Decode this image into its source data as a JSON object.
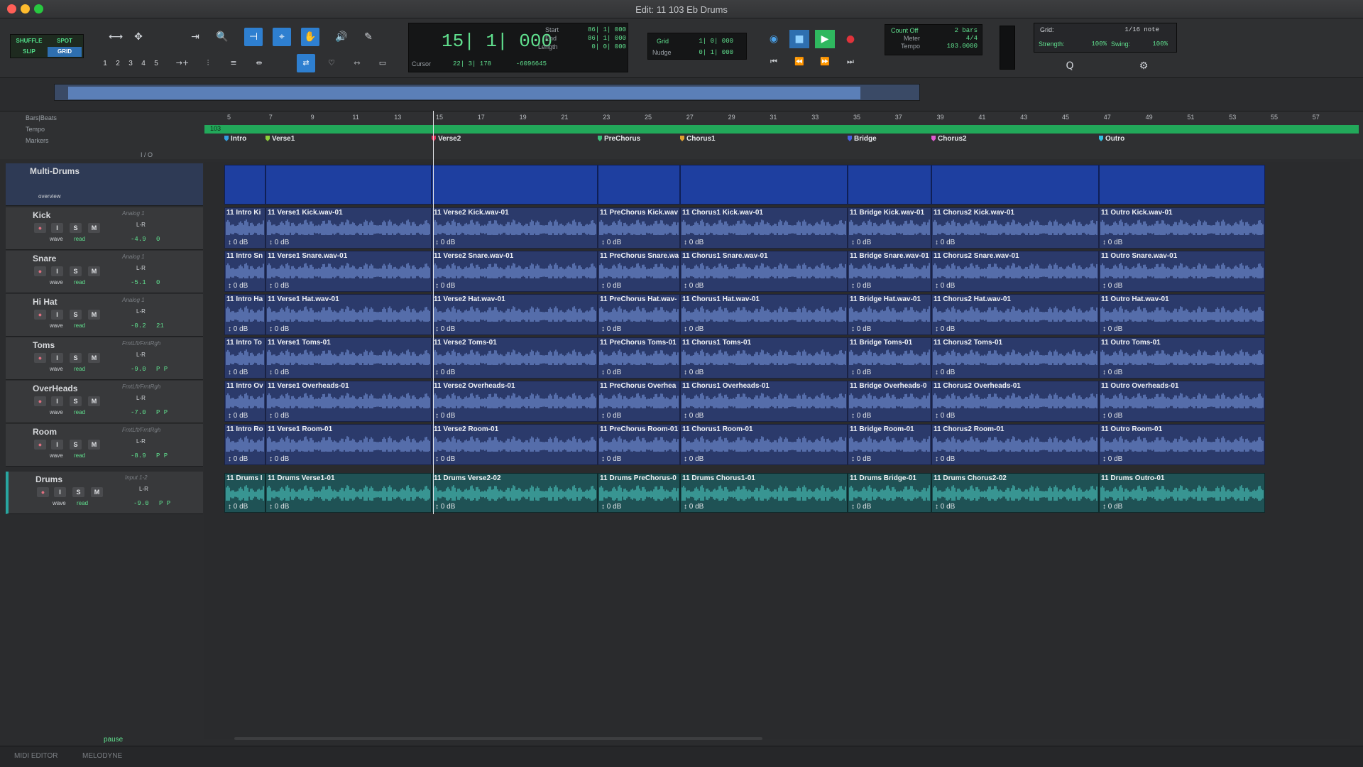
{
  "window": {
    "title": "Edit: 11 103 Eb Drums"
  },
  "edit_modes": [
    "SHUFFLE",
    "SPOT",
    "SLIP",
    "GRID"
  ],
  "zoom_presets": [
    "1",
    "2",
    "3",
    "4",
    "5"
  ],
  "counter": {
    "main": "15| 1| 000",
    "start_label": "Start",
    "start": "86| 1| 000",
    "end_label": "End",
    "end": "86| 1| 000",
    "length_label": "Length",
    "length": "0| 0| 000",
    "cursor_label": "Cursor",
    "cursor": "22| 3| 178",
    "sample": "-6096645"
  },
  "grid_nudge": {
    "grid_label": "Grid",
    "grid_value": "1| 0| 000",
    "nudge_label": "Nudge",
    "nudge_value": "0| 1| 000"
  },
  "count_meter": {
    "count": "Count Off",
    "count_value": "2 bars",
    "meter_label": "Meter",
    "meter": "4/4",
    "tempo_label": "Tempo",
    "tempo": "103.0000"
  },
  "grid_settings": {
    "grid_label": "Grid:",
    "grid_value": "1/16 note",
    "strength_label": "Strength:",
    "strength": "100%",
    "swing_label": "Swing:",
    "swing": "100%"
  },
  "rulers": {
    "bars_beats": "Bars|Beats",
    "tempo": "Tempo",
    "markers": "Markers",
    "tempo_value": "103",
    "io": "I / O"
  },
  "bar_ticks": [
    "5",
    "7",
    "9",
    "11",
    "13",
    "15",
    "17",
    "19",
    "21",
    "23",
    "25",
    "27",
    "29",
    "31",
    "33",
    "35",
    "37",
    "39",
    "41",
    "43",
    "45",
    "47",
    "49",
    "51",
    "53",
    "55",
    "57"
  ],
  "markers": [
    {
      "label": "Intro",
      "color": "#33a0e0"
    },
    {
      "label": "Verse1",
      "color": "#8ccf3a"
    },
    {
      "label": "Verse2",
      "color": "#e0335b"
    },
    {
      "label": "PreChorus",
      "color": "#3ac07a"
    },
    {
      "label": "Chorus1",
      "color": "#e0a030"
    },
    {
      "label": "Bridge",
      "color": "#4a62e0"
    },
    {
      "label": "Chorus2",
      "color": "#e05ad0"
    },
    {
      "label": "Outro",
      "color": "#33c0e0"
    }
  ],
  "multi_track": {
    "name": "Multi-Drums",
    "view": "overview"
  },
  "tracks": [
    {
      "name": "Kick",
      "input": "Analog 1",
      "pan": "L-R",
      "vol": "-4.9",
      "pan_val": "0",
      "view": "wave",
      "auto": "read",
      "clips": [
        "11 Intro Ki",
        "11 Verse1 Kick.wav-01",
        "11 Verse2 Kick.wav-01",
        "11 PreChorus Kick.wav",
        "11 Chorus1 Kick.wav-01",
        "11 Bridge Kick.wav-01",
        "11 Chorus2 Kick.wav-01",
        "11 Outro Kick.wav-01"
      ]
    },
    {
      "name": "Snare",
      "input": "Analog 1",
      "pan": "L-R",
      "vol": "-5.1",
      "pan_val": "0",
      "view": "wave",
      "auto": "read",
      "clips": [
        "11 Intro Sn",
        "11 Verse1 Snare.wav-01",
        "11 Verse2 Snare.wav-01",
        "11 PreChorus Snare.wa",
        "11 Chorus1 Snare.wav-01",
        "11 Bridge Snare.wav-01",
        "11 Chorus2 Snare.wav-01",
        "11 Outro Snare.wav-01"
      ]
    },
    {
      "name": "Hi Hat",
      "input": "Analog 1",
      "pan": "L-R",
      "vol": "-0.2",
      "pan_val": "21",
      "view": "wave",
      "auto": "read",
      "clips": [
        "11 Intro Ha",
        "11 Verse1 Hat.wav-01",
        "11 Verse2 Hat.wav-01",
        "11 PreChorus Hat.wav-",
        "11 Chorus1 Hat.wav-01",
        "11 Bridge Hat.wav-01",
        "11 Chorus2 Hat.wav-01",
        "11 Outro Hat.wav-01"
      ]
    },
    {
      "name": "Toms",
      "input": "FrntLft/FrntRgh",
      "pan": "L-R",
      "vol": "-9.0",
      "pan_val": "P  P",
      "view": "wave",
      "auto": "read",
      "clips": [
        "11 Intro To",
        "11 Verse1 Toms-01",
        "11 Verse2 Toms-01",
        "11 PreChorus Toms-01",
        "11 Chorus1 Toms-01",
        "11 Bridge Toms-01",
        "11 Chorus2 Toms-01",
        "11 Outro Toms-01"
      ]
    },
    {
      "name": "OverHeads",
      "input": "FrntLft/FrntRgh",
      "pan": "L-R",
      "vol": "-7.0",
      "pan_val": "P  P",
      "view": "wave",
      "auto": "read",
      "clips": [
        "11 Intro Ov",
        "11 Verse1 Overheads-01",
        "11 Verse2 Overheads-01",
        "11 PreChorus Overhea",
        "11 Chorus1 Overheads-01",
        "11 Bridge Overheads-0",
        "11 Chorus2 Overheads-01",
        "11 Outro Overheads-01"
      ]
    },
    {
      "name": "Room",
      "input": "FrntLft/FrntRgh",
      "pan": "L-R",
      "vol": "-8.9",
      "pan_val": "P  P",
      "view": "wave",
      "auto": "read",
      "clips": [
        "11 Intro Ro",
        "11 Verse1 Room-01",
        "11 Verse2 Room-01",
        "11 PreChorus Room-01",
        "11 Chorus1 Room-01",
        "11 Bridge Room-01",
        "11 Chorus2 Room-01",
        "11 Outro Room-01"
      ]
    }
  ],
  "drums_track": {
    "name": "Drums",
    "input": "Input 1-2",
    "pan": "L-R",
    "vol": "-9.0",
    "pan_val": "P  P",
    "view": "wave",
    "auto": "read",
    "clips": [
      "11 Drums I",
      "11 Drums Verse1-01",
      "11 Drums Verse2-02",
      "11 Drums PreChorus-0",
      "11 Drums Chorus1-01",
      "11 Drums Bridge-01",
      "11 Drums Chorus2-02",
      "11 Drums Outro-01"
    ]
  },
  "clip_gain": "0 dB",
  "track_buttons": {
    "input": "I",
    "solo": "S",
    "mute": "M"
  },
  "status": "pause",
  "bottom_tabs": [
    "MIDI EDITOR",
    "MELODYNE"
  ]
}
